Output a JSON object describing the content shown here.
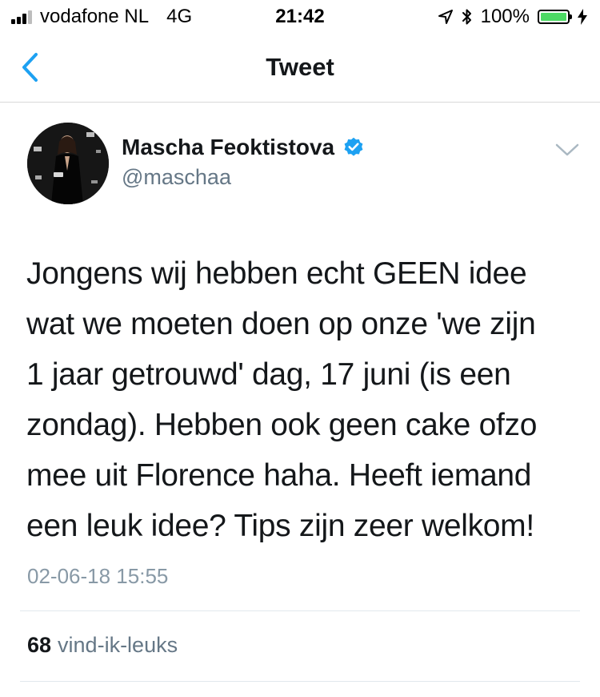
{
  "status_bar": {
    "carrier": "vodafone NL",
    "network": "4G",
    "time": "21:42",
    "battery": "100%",
    "battery_level": 1.0,
    "signal_bars": 3,
    "signal_max": 4,
    "icons": [
      "location-arrow-icon",
      "bluetooth-icon",
      "battery-icon",
      "charging-bolt-icon"
    ]
  },
  "nav": {
    "title": "Tweet",
    "back_icon": "chevron-left-icon"
  },
  "tweet": {
    "author_name": "Mascha Feoktistova",
    "author_handle": "@maschaa",
    "verified": true,
    "text_lines": [
      "Jongens wij hebben echt GEEN idee",
      "wat we moeten doen op onze 'we zijn",
      "1 jaar getrouwd' dag, 17 juni (is een",
      "zondag). Hebben ook geen cake ofzo",
      "mee uit Florence haha. Heeft iemand",
      "een leuk idee? Tips zijn zeer welkom!"
    ],
    "date": "02-06-18 15:55",
    "likes_count": "68",
    "likes_label": "vind-ik-leuks"
  },
  "colors": {
    "accent": "#1da1f2",
    "text": "#14171a",
    "secondary": "#657786",
    "muted": "#8899a6",
    "battery_green": "#4cd964"
  }
}
